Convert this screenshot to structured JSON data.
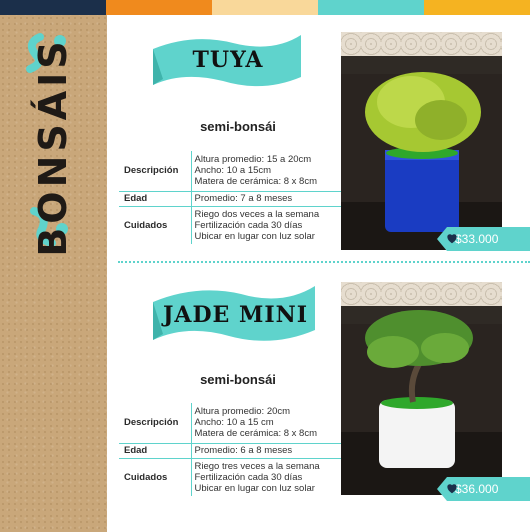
{
  "header": {
    "stripe_colors": [
      "#1b2f4a",
      "#f08a1d",
      "#f9d89a",
      "#5fd3cc",
      "#f5b321"
    ]
  },
  "sidebar": {
    "title": "BONSÁIS"
  },
  "products": [
    {
      "name": "TUYA",
      "subtitle": "semi-bonsái",
      "rows": [
        {
          "key": "Descripción",
          "value": "Altura promedio: 15 a 20cm\nAncho: 10 a 15cm\nMatera de cerámica: 8 x 8cm"
        },
        {
          "key": "Edad",
          "value": "Promedio: 7 a 8 meses"
        },
        {
          "key": "Cuidados",
          "value": "Riego dos veces a la semana\nFertilización cada 30 días\nUbicar en lugar con luz solar"
        }
      ],
      "price": "$33.000",
      "pot_color": "#1a3cc2"
    },
    {
      "name": "JADE MINI",
      "subtitle": "semi-bonsái",
      "rows": [
        {
          "key": "Descripción",
          "value": "Altura promedio: 20cm\nAncho: 10 a 15 cm\nMatera de cerámica: 8 x 8cm"
        },
        {
          "key": "Edad",
          "value": "Promedio:  6 a 8 meses"
        },
        {
          "key": "Cuidados",
          "value": "Riego tres veces a la semana\nFertilización cada 30 días\nUbicar en lugar con luz solar"
        }
      ],
      "price": "$36.000",
      "pot_color": "#f4f4f4"
    }
  ],
  "colors": {
    "accent": "#5fd3cc",
    "kraft": "#c9a77a"
  }
}
